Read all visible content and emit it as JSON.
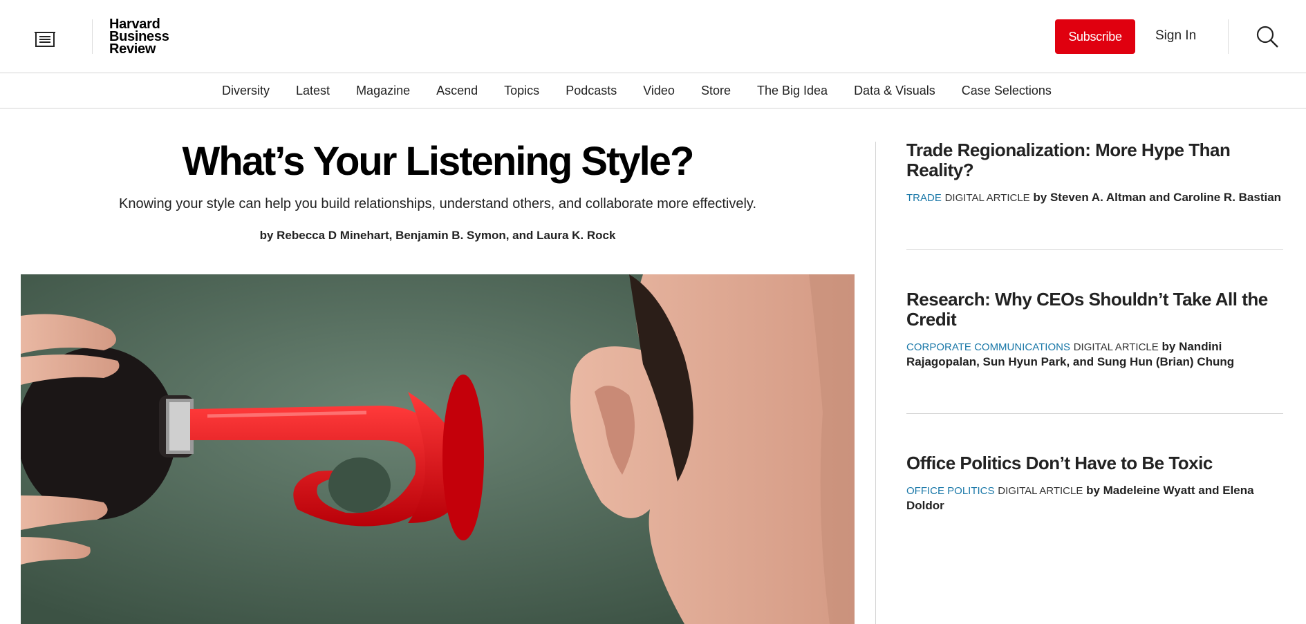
{
  "header": {
    "logo_lines": [
      "Harvard",
      "Business",
      "Review"
    ],
    "subscribe_label": "Subscribe",
    "signin_label": "Sign In",
    "menu_icon": "menu-icon",
    "search_icon": "search-icon",
    "accent_color": "#e0000f"
  },
  "nav": {
    "items": [
      "Diversity",
      "Latest",
      "Magazine",
      "Ascend",
      "Topics",
      "Podcasts",
      "Video",
      "Store",
      "The Big Idea",
      "Data & Visuals",
      "Case Selections"
    ]
  },
  "feature": {
    "title": "What’s Your Listening Style?",
    "dek": "Knowing your style can help you build relationships, understand others, and collaborate more effectively.",
    "byline": "by Rebecca D Minehart, Benjamin B. Symon, and Laura K. Rock"
  },
  "sidebar": {
    "articles": [
      {
        "title": "Trade Regionalization: More Hype Than Reality?",
        "topic": "TRADE",
        "type": "DIGITAL ARTICLE",
        "authors": "by Steven A. Altman and Caroline R. Bastian"
      },
      {
        "title": "Research: Why CEOs Shouldn’t Take All the Credit",
        "topic": "CORPORATE COMMUNICATIONS",
        "type": "DIGITAL ARTICLE",
        "authors": "by Nandini Rajagopalan, Sun Hyun Park, and Sung Hun (Brian) Chung"
      },
      {
        "title": "Office Politics Don’t Have to Be Toxic",
        "topic": "OFFICE POLITICS",
        "type": "DIGITAL ARTICLE",
        "authors": "by Madeleine Wyatt and Elena Doldor"
      }
    ],
    "topic_color": "#1a78a8"
  }
}
